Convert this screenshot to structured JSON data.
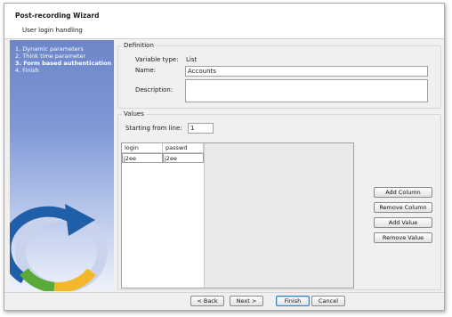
{
  "window": {
    "title": "Post-recording Wizard",
    "subtitle": "User login handling"
  },
  "sidebar": {
    "steps": [
      {
        "label": "1. Dynamic parameters",
        "current": false
      },
      {
        "label": "2. Think time parameter",
        "current": false
      },
      {
        "label": "3. Form based authentication",
        "current": true
      },
      {
        "label": "4. Finish",
        "current": false
      }
    ]
  },
  "definition": {
    "legend": "Definition",
    "variable_type_label": "Variable type:",
    "variable_type_value": "List",
    "name_label": "Name:",
    "name_value": "Accounts",
    "description_label": "Description:",
    "description_value": ""
  },
  "values": {
    "legend": "Values",
    "starting_line_label": "Starting from line:",
    "starting_line_value": "1",
    "columns": [
      "login",
      "passwd"
    ],
    "rows": [
      [
        "j2ee",
        "j2ee"
      ]
    ],
    "buttons": {
      "add_column": "Add Column",
      "remove_column": "Remove Column",
      "add_value": "Add Value",
      "remove_value": "Remove Value"
    }
  },
  "footer": {
    "back": "< Back",
    "next": "Next >",
    "finish": "Finish",
    "cancel": "Cancel"
  },
  "colors": {
    "sidebar_top": "#6d86c8",
    "logo_blue": "#1f5fa8",
    "logo_green": "#5aaa3a",
    "logo_yellow": "#f2b829",
    "default_button_border": "#3c7fb1"
  },
  "icons": {
    "wizard_logo": "circular-arrow-logo"
  }
}
